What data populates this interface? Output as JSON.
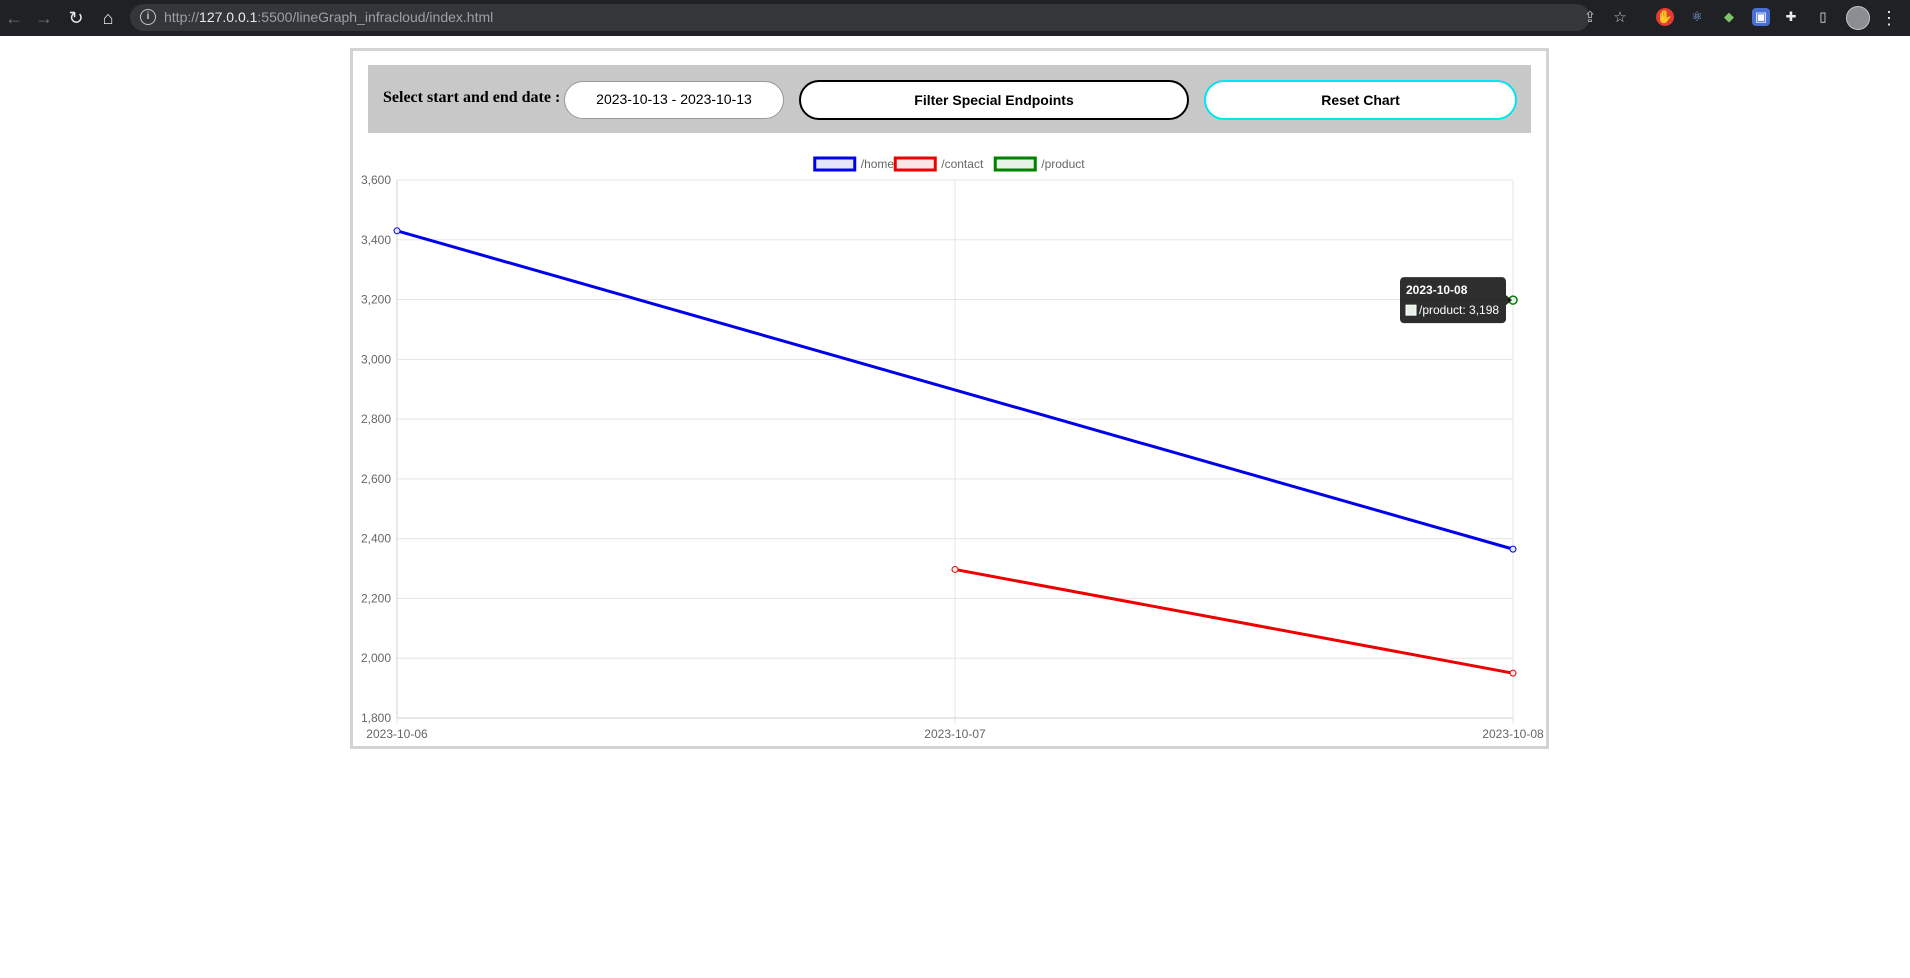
{
  "browser": {
    "url_scheme": "http://",
    "url_host": "127.0.0.1",
    "url_rest": ":5500/lineGraph_infracloud/index.html"
  },
  "controls": {
    "date_label": "Select start and end date :",
    "date_range_value": "2023-10-13 - 2023-10-13",
    "filter_button": "Filter Special Endpoints",
    "reset_button": "Reset Chart"
  },
  "chart_data": {
    "type": "line",
    "x": [
      "2023-10-06",
      "2023-10-07",
      "2023-10-08"
    ],
    "ylim": [
      1800,
      3600
    ],
    "ytick_step": 200,
    "grid": true,
    "legend_position": "top-center",
    "series": [
      {
        "name": "/home",
        "color": "#0000ee",
        "fill": "#e6e6fa",
        "values": [
          3430,
          null,
          2365
        ]
      },
      {
        "name": "/contact",
        "color": "#ee0000",
        "fill": "#fae6e6",
        "values": [
          null,
          2297,
          1950
        ]
      },
      {
        "name": "/product",
        "color": "#008000",
        "fill": "#e6f2e6",
        "values": [
          null,
          null,
          3198
        ]
      }
    ],
    "tooltip": {
      "title": "2023-10-08",
      "series": "/product",
      "value": "3,198",
      "x_index": 2
    }
  }
}
